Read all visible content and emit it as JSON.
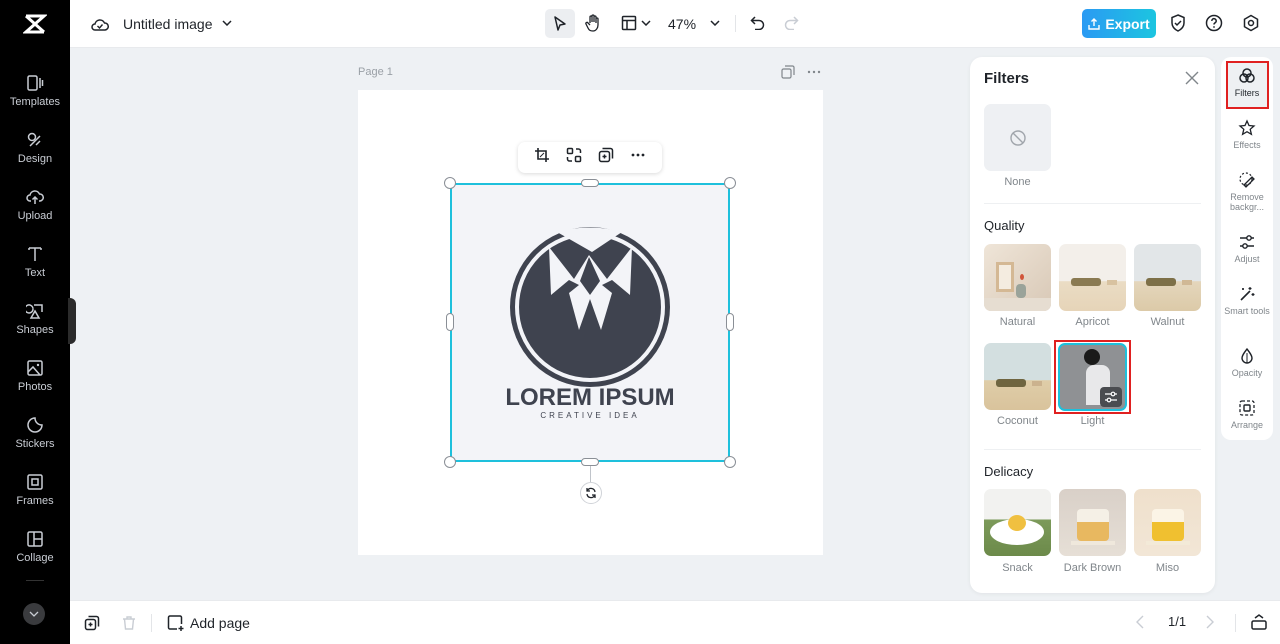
{
  "app": {
    "title": "Untitled image",
    "zoom": "47%",
    "export_label": "Export"
  },
  "sidebar": {
    "items": [
      {
        "label": "Templates",
        "icon": "templates-icon"
      },
      {
        "label": "Design",
        "icon": "design-icon"
      },
      {
        "label": "Upload",
        "icon": "upload-icon"
      },
      {
        "label": "Text",
        "icon": "text-icon"
      },
      {
        "label": "Shapes",
        "icon": "shapes-icon"
      },
      {
        "label": "Photos",
        "icon": "photos-icon"
      },
      {
        "label": "Stickers",
        "icon": "stickers-icon"
      },
      {
        "label": "Frames",
        "icon": "frames-icon"
      },
      {
        "label": "Collage",
        "icon": "collage-icon"
      }
    ]
  },
  "canvas": {
    "page_label": "Page 1",
    "logo_title": "LOREM IPSUM",
    "logo_subtitle": "CREATIVE IDEA"
  },
  "bottombar": {
    "add_page": "Add page",
    "page_counter": "1/1"
  },
  "filters_panel": {
    "title": "Filters",
    "none_label": "None",
    "sections": [
      {
        "title": "Quality",
        "items": [
          "Natural",
          "Apricot",
          "Walnut",
          "Coconut",
          "Light"
        ]
      },
      {
        "title": "Delicacy",
        "items": [
          "Snack",
          "Dark Brown",
          "Miso"
        ]
      }
    ],
    "selected": "Light"
  },
  "rightbar": {
    "items": [
      {
        "label": "Filters",
        "active": true
      },
      {
        "label": "Effects"
      },
      {
        "label": "Remove backgr..."
      },
      {
        "label": "Adjust"
      },
      {
        "label": "Smart tools"
      },
      {
        "label": "Opacity"
      },
      {
        "label": "Arrange"
      }
    ]
  },
  "colors": {
    "accent": "#1ec0dc",
    "export_start": "#2b9af3",
    "export_end": "#1cc5e0",
    "highlight": "#e02020"
  }
}
